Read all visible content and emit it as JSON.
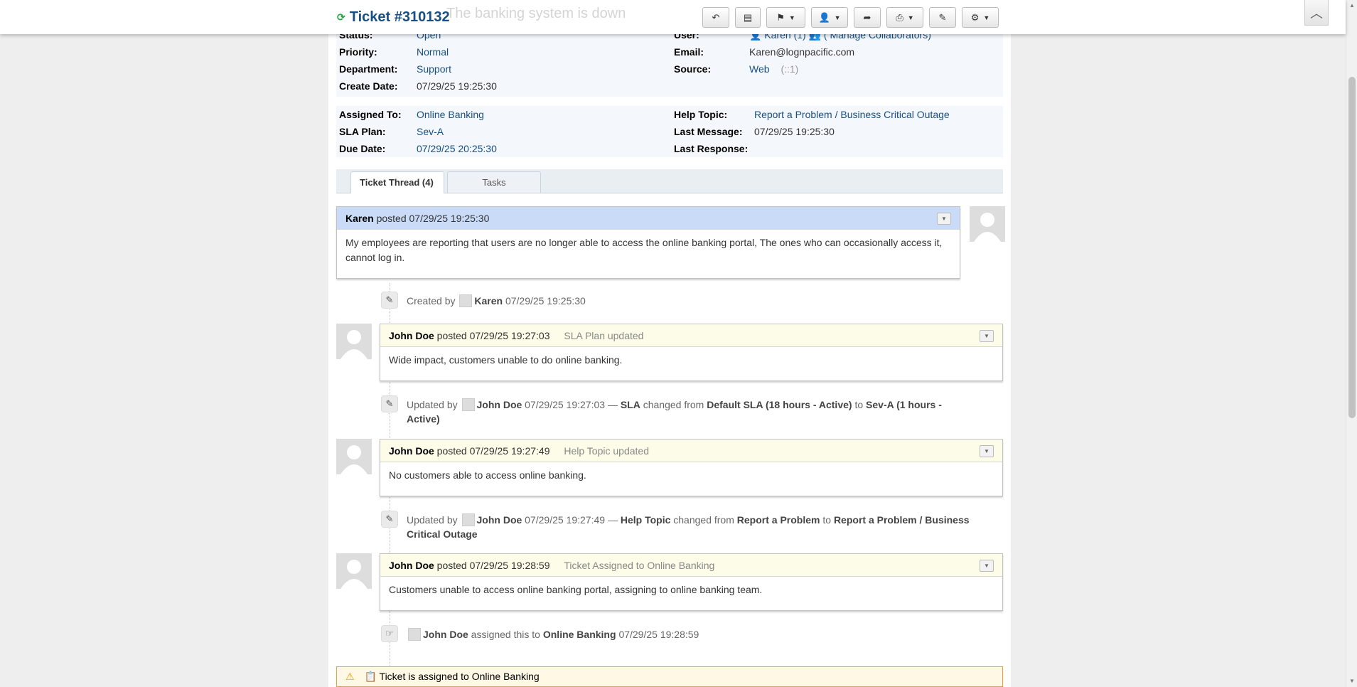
{
  "header": {
    "ticket_number": "Ticket #310132",
    "ghost_subject": "The banking system is down",
    "refresh_icon": "refresh-icon",
    "toolbar": [
      {
        "name": "reply-button",
        "icon": "↶"
      },
      {
        "name": "post-note-button",
        "icon": "▤"
      },
      {
        "name": "flag-menu-button",
        "icon": "⚑",
        "dropdown": true
      },
      {
        "name": "assign-menu-button",
        "icon": "👤",
        "dropdown": true
      },
      {
        "name": "transfer-button",
        "icon": "➦"
      },
      {
        "name": "print-menu-button",
        "icon": "⎙",
        "dropdown": true
      },
      {
        "name": "edit-button",
        "icon": "✎"
      },
      {
        "name": "settings-menu-button",
        "icon": "⚙",
        "dropdown": true
      }
    ],
    "scroll_top_icon": "︿"
  },
  "info": {
    "status_label": "Status:",
    "status_value": "Open",
    "priority_label": "Priority:",
    "priority_value": "Normal",
    "department_label": "Department:",
    "department_value": "Support",
    "create_date_label": "Create Date:",
    "create_date_value": "07/29/25 19:25:30",
    "user_label": "User:",
    "user_value": "Karen (1)",
    "collaborators_value": "( Manage Collaborators)",
    "email_label": "Email:",
    "email_value": "Karen@lognpacific.com",
    "source_label": "Source:",
    "source_value": "Web",
    "source_ip": "(::1)",
    "assigned_label": "Assigned To:",
    "assigned_value": "Online Banking",
    "sla_label": "SLA Plan:",
    "sla_value": "Sev-A",
    "due_label": "Due Date:",
    "due_value": "07/29/25 20:25:30",
    "help_topic_label": "Help Topic:",
    "help_topic_value": "Report a Problem / Business Critical Outage",
    "last_message_label": "Last Message:",
    "last_message_value": "07/29/25 19:25:30",
    "last_response_label": "Last Response:",
    "last_response_value": ""
  },
  "tabs": [
    {
      "label": "Ticket Thread (4)",
      "active": true
    },
    {
      "label": "Tasks",
      "active": false
    }
  ],
  "thread": {
    "message": {
      "author": "Karen",
      "posted_text": "posted 07/29/25 19:25:30",
      "body": "My employees are reporting that users are no longer able to access the online banking portal, The ones who can occasionally access it, cannot log in."
    },
    "event_created": {
      "prefix": "Created by",
      "user": "Karen",
      "time": "07/29/25 19:25:30"
    },
    "response1": {
      "author": "John Doe",
      "posted_text": "posted 07/29/25 19:27:03",
      "title": "SLA Plan updated",
      "body": "Wide impact, customers unable to do online banking."
    },
    "event_sla": {
      "prefix": "Updated by",
      "user": "John Doe",
      "time": "07/29/25 19:27:03 —",
      "field": "SLA",
      "changed_from": "changed from",
      "from": "Default SLA (18 hours - Active)",
      "to_word": "to",
      "to": "Sev-A (1 hours - Active)"
    },
    "response2": {
      "author": "John Doe",
      "posted_text": "posted 07/29/25 19:27:49",
      "title": "Help Topic updated",
      "body": "No customers able to access online banking."
    },
    "event_topic": {
      "prefix": "Updated by",
      "user": "John Doe",
      "time": "07/29/25 19:27:49 —",
      "field": "Help Topic",
      "changed_from": "changed from",
      "from": "Report a Problem",
      "to_word": "to",
      "to": "Report a Problem / Business Critical Outage"
    },
    "response3": {
      "author": "John Doe",
      "posted_text": "posted 07/29/25 19:28:59",
      "title": "Ticket Assigned to Online Banking",
      "body": "Customers unable to access online banking portal, assigning to online banking team."
    },
    "event_assigned": {
      "user": "John Doe",
      "middle": "assigned this to",
      "target": "Online Banking",
      "time": "07/29/25 19:28:59"
    }
  },
  "alert": {
    "text": "Ticket is assigned to Online Banking"
  },
  "colors": {
    "link": "#184e81",
    "message_header": "#c9dbf6",
    "response_header": "#fcfce8",
    "alert_border": "#f0a030"
  }
}
